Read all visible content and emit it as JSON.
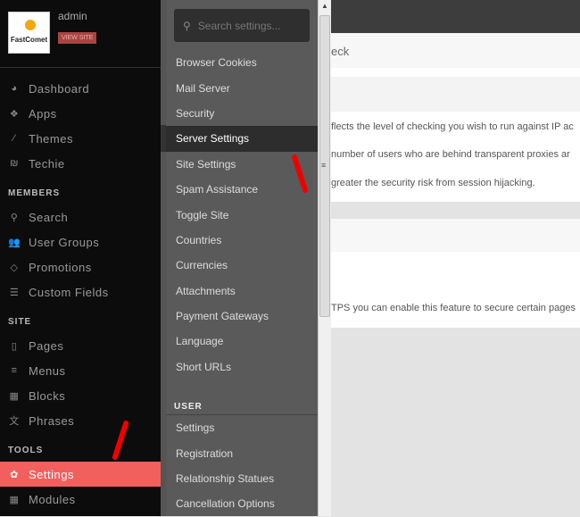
{
  "profile": {
    "username": "admin",
    "view_site": "VIEW SITE",
    "logo_text": "FastComet"
  },
  "sidebar": {
    "top": [
      {
        "label": "Dashboard",
        "icon": "dashboard-icon",
        "glyph": "◕"
      },
      {
        "label": "Apps",
        "icon": "cubes-icon",
        "glyph": "❖"
      },
      {
        "label": "Themes",
        "icon": "brush-icon",
        "glyph": "⁄"
      },
      {
        "label": "Techie",
        "icon": "techie-icon",
        "glyph": "₪"
      }
    ],
    "members_title": "MEMBERS",
    "members": [
      {
        "label": "Search",
        "icon": "search-icon",
        "glyph": "⚲"
      },
      {
        "label": "User Groups",
        "icon": "users-icon",
        "glyph": "👥"
      },
      {
        "label": "Promotions",
        "icon": "diamond-icon",
        "glyph": "◇"
      },
      {
        "label": "Custom Fields",
        "icon": "list-icon",
        "glyph": "☰"
      }
    ],
    "site_title": "SITE",
    "site": [
      {
        "label": "Pages",
        "icon": "file-icon",
        "glyph": "▯"
      },
      {
        "label": "Menus",
        "icon": "menu-icon",
        "glyph": "≡"
      },
      {
        "label": "Blocks",
        "icon": "grid-icon",
        "glyph": "▦"
      },
      {
        "label": "Phrases",
        "icon": "language-icon",
        "glyph": "文"
      }
    ],
    "tools_title": "TOOLS",
    "tools": [
      {
        "label": "Settings",
        "icon": "gear-icon",
        "glyph": "✿",
        "active": true
      },
      {
        "label": "Modules",
        "icon": "modules-icon",
        "glyph": "▦"
      }
    ]
  },
  "settings_menu": {
    "search_placeholder": "Search settings...",
    "items": [
      "Browser Cookies",
      "Mail Server",
      "Security",
      "Server Settings",
      "Site Settings",
      "Spam Assistance",
      "Toggle Site",
      "Countries",
      "Currencies",
      "Attachments",
      "Payment Gateways",
      "Language",
      "Short URLs"
    ],
    "selected": "Server Settings",
    "user_title": "USER",
    "user_items": [
      "Settings",
      "Registration",
      "Relationship Statues",
      "Cancellation Options"
    ]
  },
  "main": {
    "heading_fragment": "eck",
    "lines": [
      "flects the level of checking you wish to run against IP ac",
      "number of users who are behind transparent proxies ar",
      "greater the security risk from session hijacking."
    ],
    "https_line": "TPS you can enable this feature to secure certain pages"
  },
  "colors": {
    "active": "#f2605e",
    "annotation_arrow": "#e00000"
  }
}
